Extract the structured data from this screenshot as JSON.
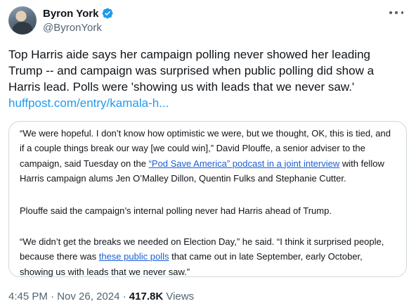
{
  "author": {
    "display_name": "Byron York",
    "handle": "@ByronYork"
  },
  "tweet": {
    "text": "Top Harris aide says her campaign polling never showed her leading Trump -- and campaign was surprised when public polling did show a Harris lead. Polls were 'showing us with leads that we never saw.'",
    "link": "huffpost.com/entry/kamala-h..."
  },
  "quote": {
    "p1_a": "“We were hopeful. I don’t know how optimistic we were, but we thought, OK, this is tied, and if a couple things break our way [we could win],” David Plouffe, a senior adviser to the campaign, said Tuesday on the ",
    "p1_link": "“Pod Save America” podcast in a joint interview",
    "p1_b": " with fellow Harris campaign alums Jen O’Malley Dillon, Quentin Fulks and Stephanie Cutter.",
    "p2": "Plouffe said the campaign’s internal polling never had Harris ahead of Trump.",
    "p3_a": "“We didn’t get the breaks we needed on Election Day,” he said. “I think it surprised people, because there was ",
    "p3_link": "these public polls",
    "p3_b": " that came out in late September, early October, showing us with leads that we never saw.”"
  },
  "meta": {
    "time": "4:45 PM",
    "sep1": " · ",
    "date": "Nov 26, 2024",
    "sep2": " · ",
    "views_count": "417.8K",
    "views_label": " Views"
  },
  "icons": {
    "verified": "verified-badge-icon",
    "more": "more-horizontal-icon"
  },
  "colors": {
    "accent": "#1d9bf0",
    "article_link": "#1a5fd6",
    "secondary_text": "#536471"
  }
}
